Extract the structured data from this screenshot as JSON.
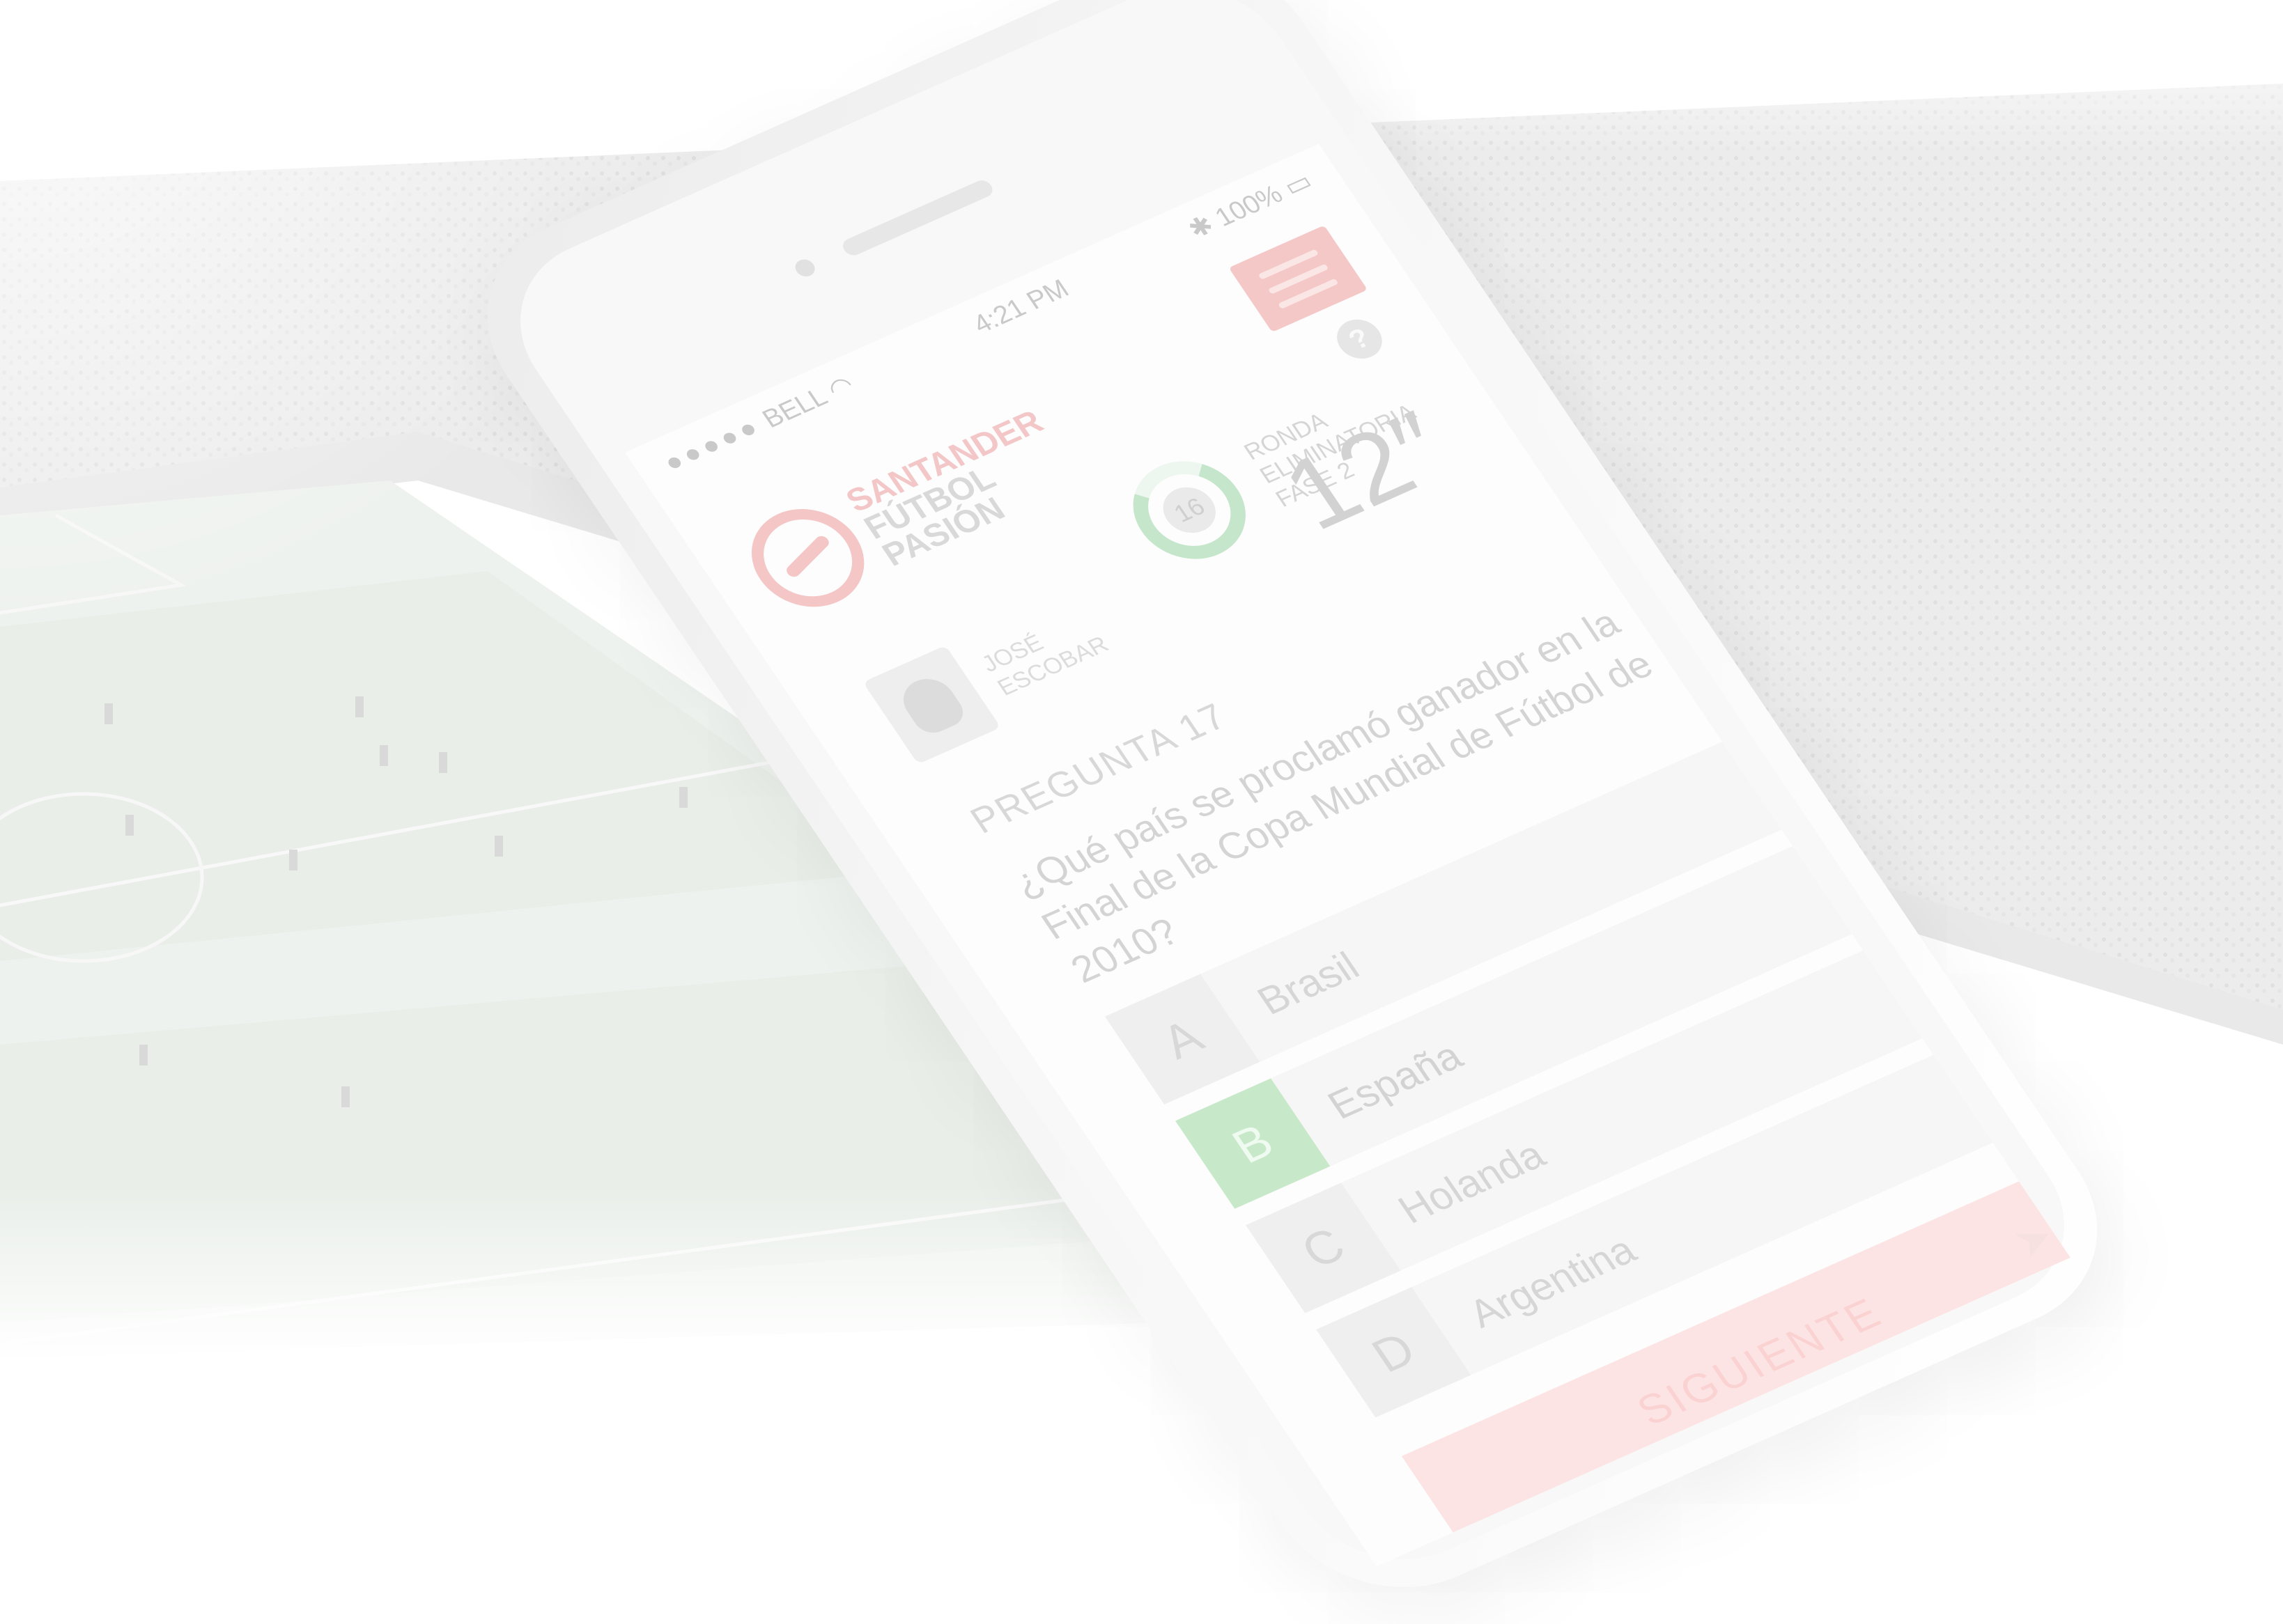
{
  "status_bar": {
    "signal": "●●●●●",
    "carrier": "BELL",
    "time": "4:21 PM",
    "battery": "100%"
  },
  "logo": {
    "brand": "SANTANDER",
    "line1": "FÚTBOL",
    "line2": "PASIÓN"
  },
  "round": {
    "number": "16",
    "line1": "RONDA",
    "line2": "ELIMINATORIA",
    "line3": "FASE 2"
  },
  "timer": "12″",
  "player": {
    "first_name": "JOSÉ",
    "last_name": "ESCOBAR"
  },
  "question": {
    "label": "PREGUNTA 17",
    "text": "¿Qué país se proclamó ganador en la Final de la Copa Mundial de Fútbol de 2010?"
  },
  "answers": [
    {
      "letter": "A",
      "text": "Brasil",
      "selected": false
    },
    {
      "letter": "B",
      "text": "España",
      "selected": true
    },
    {
      "letter": "C",
      "text": "Holanda",
      "selected": false
    },
    {
      "letter": "D",
      "text": "Argentina",
      "selected": false
    }
  ],
  "next_button": {
    "label": "SIGUIENTE",
    "icon": "arrow-icon"
  },
  "help_icon": "?",
  "colors": {
    "accent_red": "#f4c6c6",
    "accent_green": "#c8e9c9"
  }
}
